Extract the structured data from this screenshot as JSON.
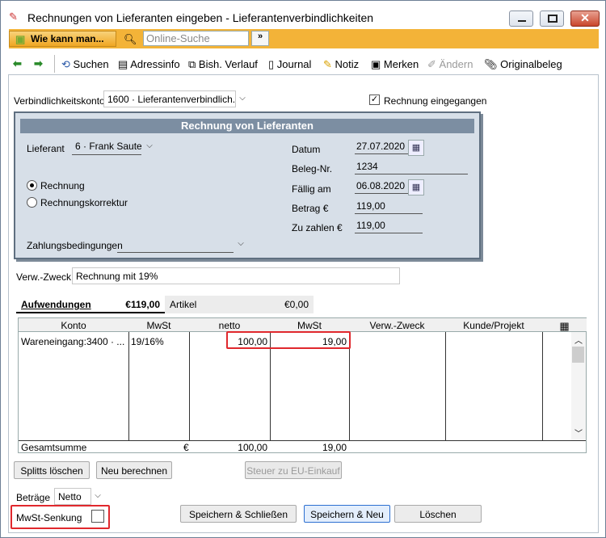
{
  "window": {
    "title": "Rechnungen von Lieferanten eingeben - Lieferantenverbindlichkeiten"
  },
  "searchbar": {
    "help_label": "Wie kann man...",
    "search_placeholder": "Online-Suche",
    "go_label": "»"
  },
  "toolbar": {
    "suchen": "Suchen",
    "adressinfo": "Adressinfo",
    "verlauf": "Bish. Verlauf",
    "journal": "Journal",
    "notiz": "Notiz",
    "merken": "Merken",
    "andern": "Ändern",
    "originalbeleg": "Originalbeleg"
  },
  "account": {
    "label": "Verbindlichkeitskonto",
    "value": "1600 · Lieferantenverbindlich...",
    "received_label": "Rechnung eingegangen",
    "received_checked": true
  },
  "panel": {
    "title": "Rechnung von Lieferanten",
    "supplier_label": "Lieferant",
    "supplier_value": "6 · Frank Sauter",
    "radio_invoice": "Rechnung",
    "radio_correction": "Rechnungskorrektur",
    "payment_terms_label": "Zahlungsbedingungen",
    "payment_terms_value": "",
    "date_label": "Datum",
    "date_value": "27.07.2020",
    "beleg_label": "Beleg-Nr.",
    "beleg_value": "1234",
    "due_label": "Fällig am",
    "due_value": "06.08.2020",
    "amount_label": "Betrag €",
    "amount_value": "119,00",
    "topay_label": "Zu zahlen €",
    "topay_value": "119,00"
  },
  "purpose": {
    "label": "Verw.-Zweck",
    "value": "Rechnung mit 19%"
  },
  "tabs": [
    {
      "label": "Aufwendungen",
      "amount": "€119,00"
    },
    {
      "label": "Artikel",
      "amount": "€0,00"
    }
  ],
  "grid": {
    "headers": [
      "Konto",
      "MwSt",
      "netto",
      "MwSt",
      "Verw.-Zweck",
      "Kunde/Projekt"
    ],
    "rows": [
      {
        "konto": "Wareneingang:3400 · ...",
        "mwst_code": "19/16%",
        "netto": "100,00",
        "mwst": "19,00"
      }
    ],
    "total_label": "Gesamtsumme",
    "total_currency": "€",
    "total_netto": "100,00",
    "total_mwst": "19,00"
  },
  "buttons": {
    "splits": "Splitts löschen",
    "recalc": "Neu berechnen",
    "eu": "Steuer zu EU-Einkauf",
    "save_close": "Speichern & Schließen",
    "save_new": "Speichern & Neu",
    "delete": "Löschen"
  },
  "amounts": {
    "label": "Beträge",
    "value": "Netto"
  },
  "vat": {
    "label": "MwSt-Senkung",
    "checked": false
  },
  "colors": {
    "highlight": "#e0282d",
    "search_bar": "#f3b338",
    "panel_header": "#7c8ea2"
  }
}
